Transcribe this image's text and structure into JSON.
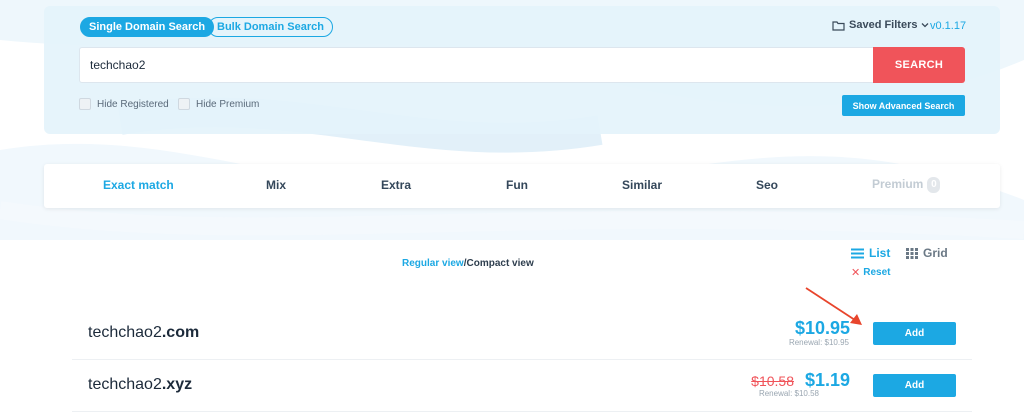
{
  "search_modes": {
    "single_label": "Single Domain Search",
    "bulk_label": "Bulk Domain Search"
  },
  "header": {
    "saved_filters_label": "Saved Filters",
    "version": "v0.1.17"
  },
  "search": {
    "value": "techchao2",
    "button_label": "SEARCH"
  },
  "filters": {
    "hide_registered_label": "Hide Registered",
    "hide_premium_label": "Hide Premium",
    "advanced_label": "Show Advanced Search"
  },
  "tabs": [
    {
      "label": "Exact match"
    },
    {
      "label": "Mix"
    },
    {
      "label": "Extra"
    },
    {
      "label": "Fun"
    },
    {
      "label": "Similar"
    },
    {
      "label": "Seo"
    },
    {
      "label": "Premium",
      "count": "0"
    }
  ],
  "view": {
    "regular_label": "Regular view",
    "separator": "/",
    "compact_label": "Compact view",
    "list_label": "List",
    "grid_label": "Grid",
    "reset_label": "Reset"
  },
  "results": [
    {
      "name": "techchao2",
      "tld": ".com",
      "price": "$10.95",
      "renewal": "Renewal: $10.95",
      "add_label": "Add"
    },
    {
      "name": "techchao2",
      "tld": ".xyz",
      "old_price": "$10.58",
      "price": "$1.19",
      "renewal": "Renewal: $10.58",
      "add_label": "Add"
    }
  ],
  "colors": {
    "accent": "#1ca8e3",
    "danger": "#f0545a",
    "annotation_arrow": "#e8452c"
  },
  "icons": {
    "saved_filters": "folder-icon",
    "dropdown": "chevron-down-icon",
    "list": "list-icon",
    "grid": "grid-icon",
    "reset": "close-icon"
  }
}
